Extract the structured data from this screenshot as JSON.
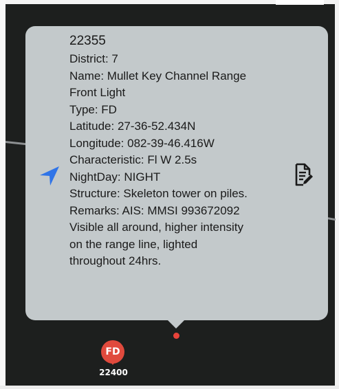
{
  "popup": {
    "id": "22355",
    "district": "District: 7",
    "name_line1": "Name: Mullet Key Channel Range",
    "name_line2": "Front Light",
    "type": "Type: FD",
    "latitude": "Latitude: 27-36-52.434N",
    "longitude": "Longitude: 082-39-46.416W",
    "characteristic": "Characteristic: Fl W 2.5s",
    "nightday": "NightDay: NIGHT",
    "structure": "Structure: Skeleton tower on piles.",
    "remarks_line1": "Remarks: AIS: MMSI 993672092",
    "remarks_line2": "Visible all around, higher intensity",
    "remarks_line3": "on the range line, lighted",
    "remarks_line4": "throughout 24hrs.",
    "left_icon": "navigation-arrow-icon",
    "right_icon": "notes-edit-icon"
  },
  "markers": [
    {
      "code": "FD",
      "label": "22400",
      "color": "#e04a3d",
      "icon": "map-pin-icon"
    }
  ],
  "colors": {
    "callout_bg": "#c3c9cb",
    "accent_blue": "#2f74e8",
    "marker_red": "#e04a3d",
    "map_bg": "#1d1f1e"
  }
}
